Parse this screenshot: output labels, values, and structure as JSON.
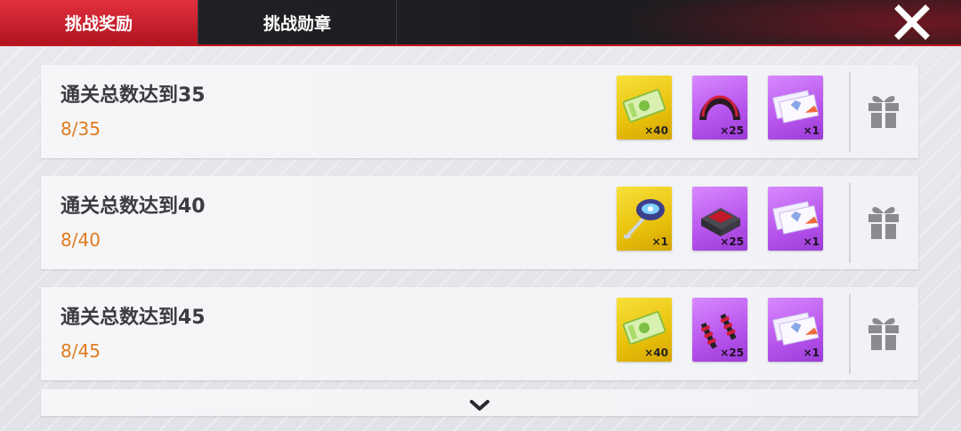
{
  "tabs": [
    {
      "label": "挑战奖励",
      "active": true
    },
    {
      "label": "挑战勋章",
      "active": false
    }
  ],
  "colors": {
    "accent_red": "#c2171f",
    "progress_orange": "#e07b1e",
    "item_gold": "#efcc16",
    "item_purple": "#c06af0"
  },
  "rows": [
    {
      "title": "通关总数达到35",
      "progress": "8/35",
      "rewards": [
        {
          "icon": "green-ticket-icon",
          "rarity": "gold",
          "qty": "×40"
        },
        {
          "icon": "tire-icon",
          "rarity": "purple",
          "qty": "×25"
        },
        {
          "icon": "voucher-tickets-icon",
          "rarity": "purple",
          "qty": "×1"
        }
      ]
    },
    {
      "title": "通关总数达到40",
      "progress": "8/40",
      "rewards": [
        {
          "icon": "car-key-icon",
          "rarity": "gold",
          "qty": "×1"
        },
        {
          "icon": "engine-part-icon",
          "rarity": "purple",
          "qty": "×25"
        },
        {
          "icon": "voucher-tickets-icon",
          "rarity": "purple",
          "qty": "×1"
        }
      ]
    },
    {
      "title": "通关总数达到45",
      "progress": "8/45",
      "rewards": [
        {
          "icon": "green-ticket-icon",
          "rarity": "gold",
          "qty": "×40"
        },
        {
          "icon": "shock-absorber-icon",
          "rarity": "purple",
          "qty": "×25"
        },
        {
          "icon": "voucher-tickets-icon",
          "rarity": "purple",
          "qty": "×1"
        }
      ]
    }
  ]
}
